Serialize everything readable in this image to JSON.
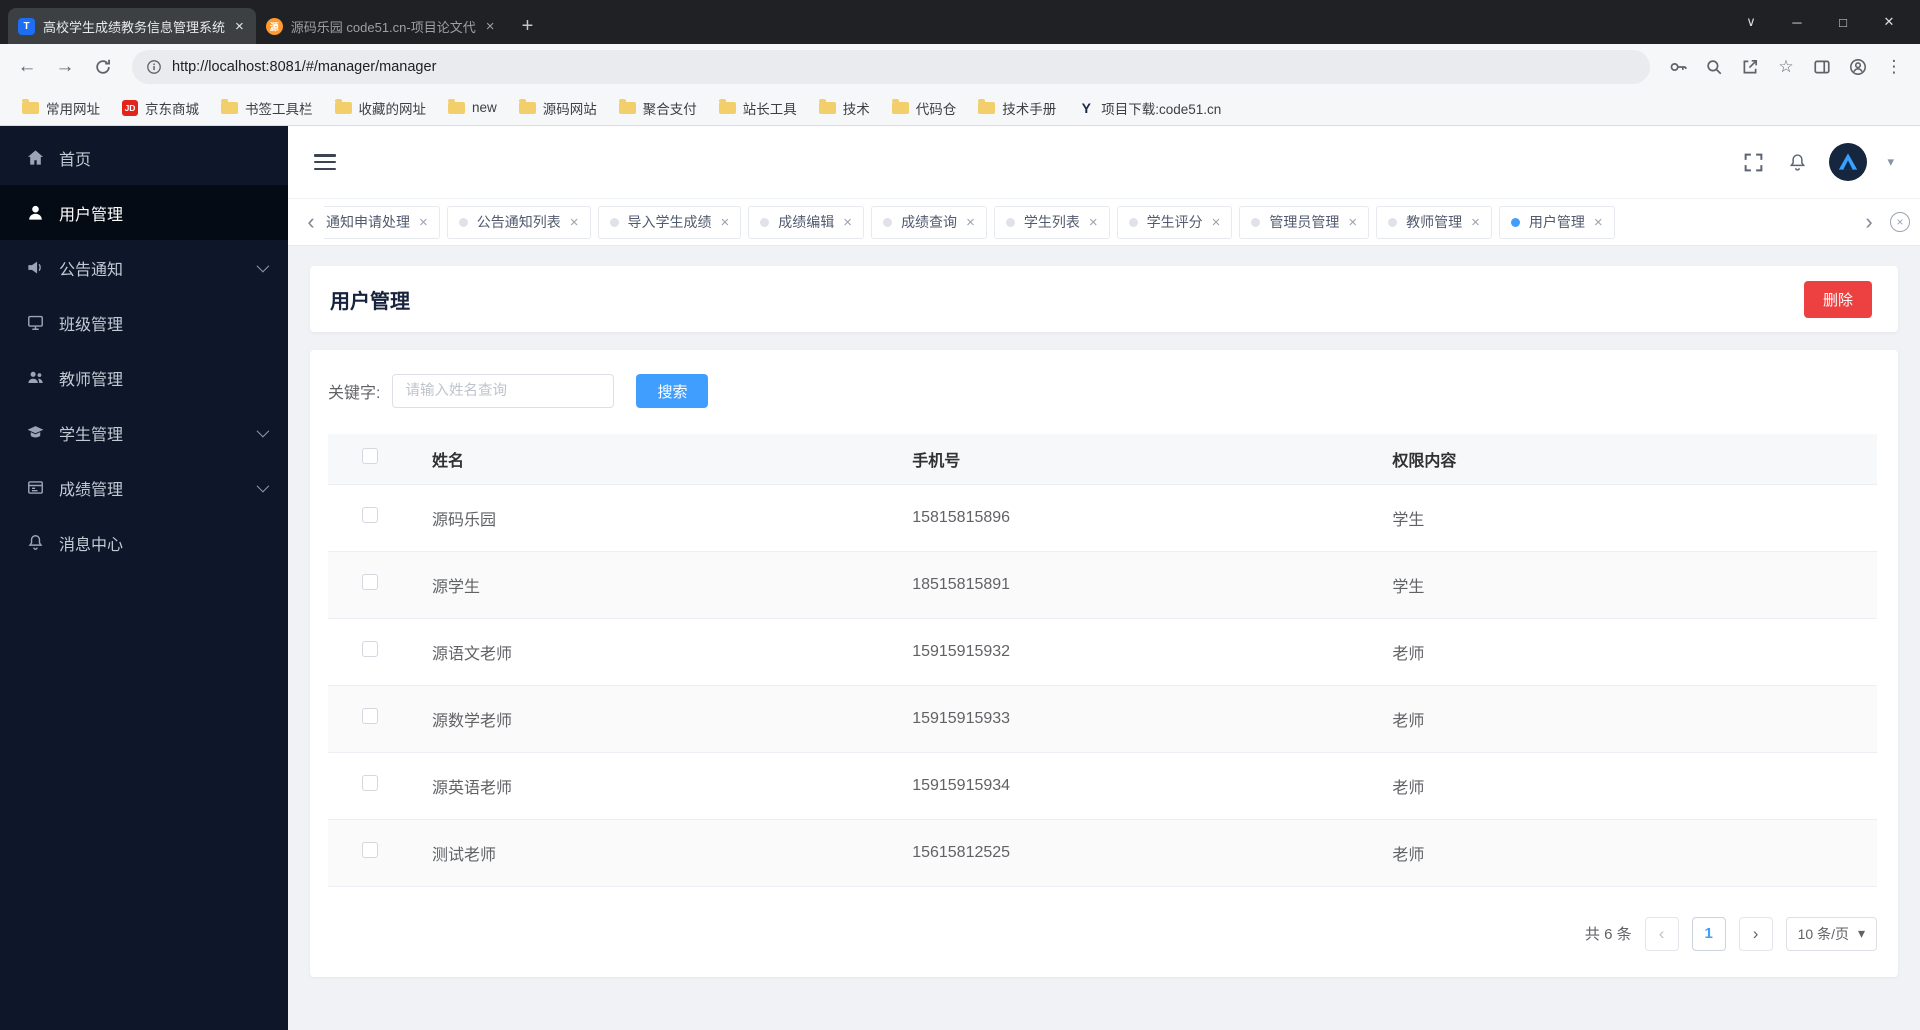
{
  "browser": {
    "tab1": {
      "title": "高校学生成绩教务信息管理系统",
      "favicon": "T"
    },
    "tab2": {
      "title": "源码乐园 code51.cn-项目论文代",
      "favicon": "源"
    },
    "url": "http://localhost:8081/#/manager/manager",
    "bookmarks": [
      {
        "label": "常用网址"
      },
      {
        "label": "京东商城",
        "badge": "JD"
      },
      {
        "label": "书签工具栏"
      },
      {
        "label": "收藏的网址"
      },
      {
        "label": "new"
      },
      {
        "label": "源码网站"
      },
      {
        "label": "聚合支付"
      },
      {
        "label": "站长工具"
      },
      {
        "label": "技术"
      },
      {
        "label": "代码仓"
      },
      {
        "label": "技术手册"
      },
      {
        "label": "项目下载:code51.cn",
        "badge": "Y"
      }
    ]
  },
  "icons": {
    "close": "×",
    "new_tab": "+",
    "tab_search": "∨",
    "minimize": "─",
    "maximize": "□",
    "win_close": "✕",
    "back": "←",
    "forward": "→",
    "star": "☆",
    "menu_dots": "⋮",
    "chevron_left": "‹",
    "chevron_right": "›",
    "caret_down": "▾"
  },
  "sidebar": {
    "items": [
      {
        "label": "首页"
      },
      {
        "label": "用户管理"
      },
      {
        "label": "公告通知"
      },
      {
        "label": "班级管理"
      },
      {
        "label": "教师管理"
      },
      {
        "label": "学生管理"
      },
      {
        "label": "成绩管理"
      },
      {
        "label": "消息中心"
      }
    ]
  },
  "tabbar": {
    "tabs": [
      {
        "label": "通知申请处理"
      },
      {
        "label": "公告通知列表"
      },
      {
        "label": "导入学生成绩"
      },
      {
        "label": "成绩编辑"
      },
      {
        "label": "成绩查询"
      },
      {
        "label": "学生列表"
      },
      {
        "label": "学生评分"
      },
      {
        "label": "管理员管理"
      },
      {
        "label": "教师管理"
      },
      {
        "label": "用户管理"
      }
    ]
  },
  "page": {
    "title": "用户管理",
    "delete_button": "删除",
    "search": {
      "label": "关键字:",
      "placeholder": "请输入姓名查询",
      "button": "搜索"
    }
  },
  "table": {
    "headers": {
      "name": "姓名",
      "phone": "手机号",
      "role": "权限内容"
    },
    "rows": [
      {
        "name": "源码乐园",
        "phone": "15815815896",
        "role": "学生"
      },
      {
        "name": "源学生",
        "phone": "18515815891",
        "role": "学生"
      },
      {
        "name": "源语文老师",
        "phone": "15915915932",
        "role": "老师"
      },
      {
        "name": "源数学老师",
        "phone": "15915915933",
        "role": "老师"
      },
      {
        "name": "源英语老师",
        "phone": "15915915934",
        "role": "老师"
      },
      {
        "name": "测试老师",
        "phone": "15615812525",
        "role": "老师"
      }
    ]
  },
  "pagination": {
    "total": "共 6 条",
    "page": "1",
    "page_size": "10 条/页"
  },
  "colors": {
    "primary": "#409eff",
    "danger": "#ed4141",
    "sidebar_bg": "#0d1729",
    "chrome_bg": "#202124"
  }
}
